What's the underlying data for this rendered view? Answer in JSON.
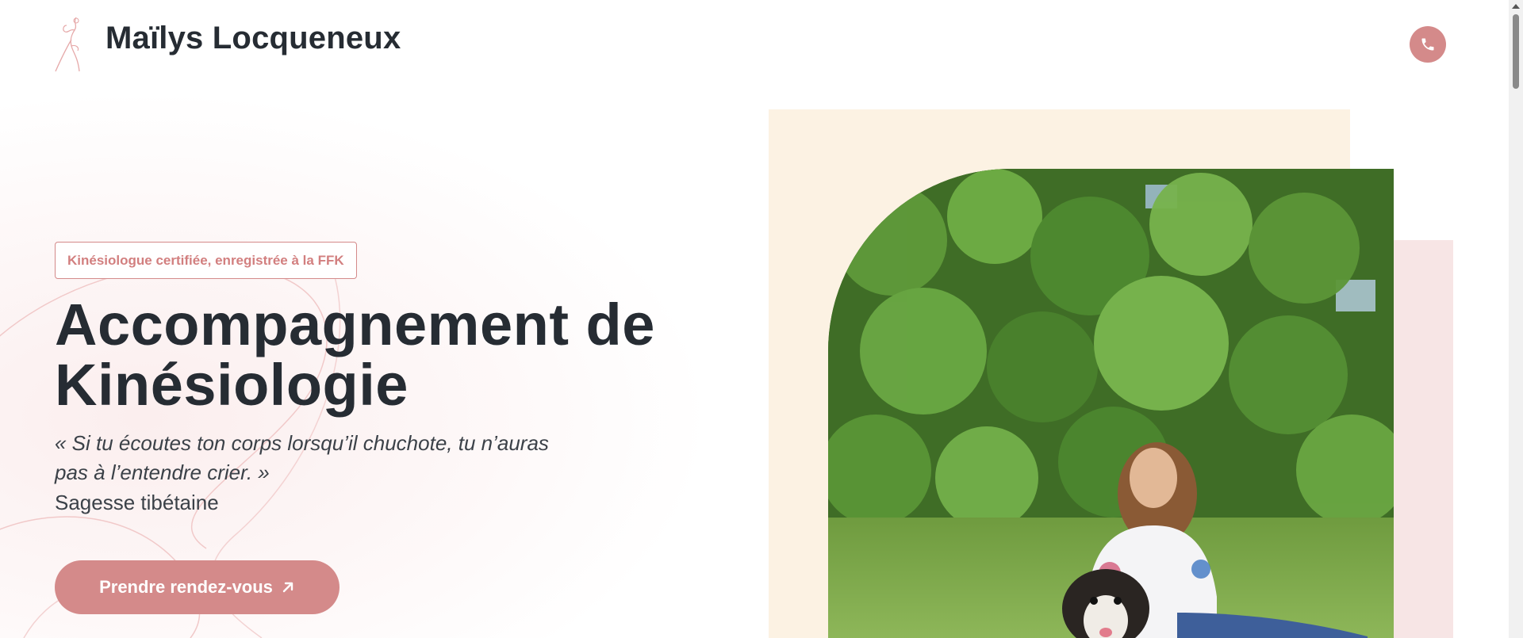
{
  "header": {
    "brand": "Maïlys Locqueneux",
    "logo_icon": "woman-line-art-icon",
    "phone_icon": "phone-icon"
  },
  "hero": {
    "badge": "Kinésiologue certifiée, enregistrée à la FFK",
    "title_line1": "Accompagnement de",
    "title_line2": "Kinésiologie",
    "quote_line1": "« Si tu écoutes ton corps lorsqu’il chuchote, tu n’auras",
    "quote_line2": "pas à l’entendre crier. »",
    "quote_author": "Sagesse tibétaine",
    "cta_label": "Prendre rendez-vous",
    "cta_icon": "arrow-up-right-icon"
  },
  "colors": {
    "accent": "#d48a8a",
    "heading": "#262c33",
    "cream": "#fcf2e3",
    "pink_light": "#f7e5e5"
  }
}
